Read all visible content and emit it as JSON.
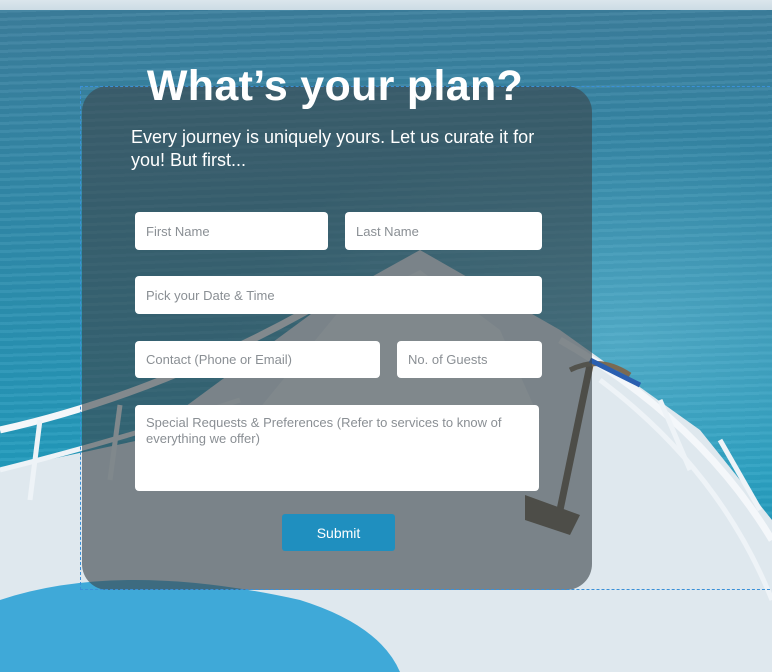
{
  "form": {
    "title": "What’s your plan?",
    "subtitle": "Every journey is uniquely yours. Let us curate it for you! But first...",
    "fields": {
      "first_name": "First Name",
      "last_name": "Last Name",
      "date_time": "Pick your Date & Time",
      "contact": "Contact (Phone or Email)",
      "guests": "No. of Guests",
      "requests": "Special Requests & Preferences (Refer to services to know of everything we offer)"
    },
    "submit_label": "Submit"
  },
  "colors": {
    "accent": "#1f8fbf",
    "card_overlay": "rgba(60,70,75,0.62)",
    "sea": "#229cbe"
  },
  "icons": {
    "background": "boat-bow-on-sea-image"
  }
}
